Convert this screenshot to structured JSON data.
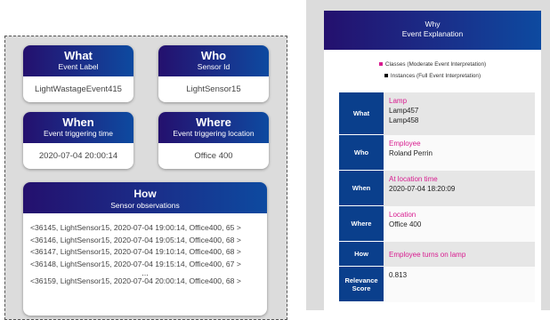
{
  "what": {
    "title": "What",
    "subtitle": "Event Label",
    "value": "LightWastageEvent415"
  },
  "who": {
    "title": "Who",
    "subtitle": "Sensor Id",
    "value": "LightSensor15"
  },
  "when": {
    "title": "When",
    "subtitle": "Event triggering time",
    "value": "2020-07-04 20:00:14"
  },
  "where": {
    "title": "Where",
    "subtitle": "Event triggering location",
    "value": "Office 400"
  },
  "how": {
    "title": "How",
    "subtitle": "Sensor observations",
    "observations": [
      "<36145, LightSensor15, 2020-07-04 19:00:14, Office400, 65 >",
      "<36146, LightSensor15, 2020-07-04 19:05:14, Office400, 68 >",
      "<36147, LightSensor15, 2020-07-04 19:10:14, Office400, 68 >",
      "<36148, LightSensor15, 2020-07-04 19:15:14, Office400, 67 >"
    ],
    "ellipsis": "...",
    "last_observation": "<36159, LightSensor15, 2020-07-04 20:00:14, Office400, 68 >"
  },
  "why": {
    "title": "Why",
    "subtitle": "Event Explanation",
    "legend": {
      "classes": "Classes (Moderate Event Interpretation)",
      "instances": "Instances (Full Event Interpretation)",
      "classes_color": "#d81b8f",
      "instances_color": "#000000"
    },
    "rows": [
      {
        "label": "What",
        "class": "Lamp",
        "instances": [
          "Lamp457",
          "Lamp458"
        ]
      },
      {
        "label": "Who",
        "class": "Employee",
        "instances": [
          "Roland Perrin"
        ]
      },
      {
        "label": "When",
        "class": "At location time",
        "instances": [
          "2020-07-04 18:20:09"
        ]
      },
      {
        "label": "Where",
        "class": "Location",
        "instances": [
          "Office 400"
        ]
      },
      {
        "label": "How",
        "class": "Employee turns on lamp",
        "instances": []
      },
      {
        "label": "Relevance Score",
        "class": "",
        "instances": [
          "0.813"
        ]
      }
    ]
  },
  "colors": {
    "header_start": "#24106e",
    "header_end": "#0d4aa0",
    "label_bg": "#0a3f8c",
    "class_text": "#d81b8f"
  }
}
